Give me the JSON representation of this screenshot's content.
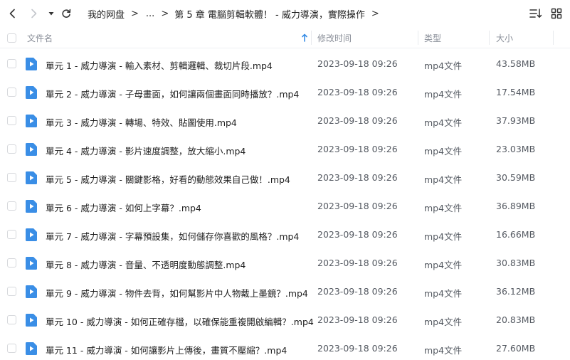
{
  "toolbar": {
    "back_icon": "chevron-left-icon",
    "forward_icon": "chevron-right-icon",
    "history_icon": "caret-down-icon",
    "refresh_icon": "refresh-icon",
    "sort_icon": "sort-list-icon",
    "view_icon": "grid-view-icon"
  },
  "breadcrumb": {
    "root": "我的网盘",
    "ellipsis": "...",
    "current": "第 5 章 電腦剪輯軟體！ - 威力導演，實際操作",
    "separator": ">"
  },
  "header": {
    "name": "文件名",
    "modified": "修改时间",
    "type": "类型",
    "size": "大小"
  },
  "colors": {
    "file_icon": "#3a8ee6",
    "sort_arrow": "#3a8ee6",
    "header_text": "#8a8f99"
  },
  "files": [
    {
      "name": "單元 1 - 威力導演 - 輸入素材、剪輯邏輯、裁切片段.mp4",
      "modified": "2023-09-18 09:26",
      "type": "mp4文件",
      "size": "43.58MB"
    },
    {
      "name": "單元 2 - 威力導演 - 子母畫面，如何讓兩個畫面同時播放？.mp4",
      "modified": "2023-09-18 09:26",
      "type": "mp4文件",
      "size": "17.54MB"
    },
    {
      "name": "單元 3 - 威力導演 - 轉場、特效、貼圖使用.mp4",
      "modified": "2023-09-18 09:26",
      "type": "mp4文件",
      "size": "37.93MB"
    },
    {
      "name": "單元 4 - 威力導演 - 影片速度調整，放大縮小.mp4",
      "modified": "2023-09-18 09:26",
      "type": "mp4文件",
      "size": "23.03MB"
    },
    {
      "name": "單元 5 - 威力導演 - 關鍵影格，好看的動態效果自己做！.mp4",
      "modified": "2023-09-18 09:26",
      "type": "mp4文件",
      "size": "30.59MB"
    },
    {
      "name": "單元 6 - 威力導演 - 如何上字幕？.mp4",
      "modified": "2023-09-18 09:26",
      "type": "mp4文件",
      "size": "36.89MB"
    },
    {
      "name": "單元 7 - 威力導演 - 字幕預設集，如何儲存你喜歡的風格？.mp4",
      "modified": "2023-09-18 09:26",
      "type": "mp4文件",
      "size": "16.66MB"
    },
    {
      "name": "單元 8 - 威力導演 - 音量、不透明度動態調整.mp4",
      "modified": "2023-09-18 09:26",
      "type": "mp4文件",
      "size": "30.83MB"
    },
    {
      "name": "單元 9 - 威力導演 - 物件去背，如何幫影片中人物戴上墨鏡？.mp4",
      "modified": "2023-09-18 09:26",
      "type": "mp4文件",
      "size": "36.12MB"
    },
    {
      "name": "單元 10 - 威力導演 - 如何正確存檔，以確保能重複開啟編輯？.mp4",
      "modified": "2023-09-18 09:26",
      "type": "mp4文件",
      "size": "20.83MB"
    },
    {
      "name": "單元 11 - 威力導演 - 如何讓影片上傳後，畫質不壓縮？.mp4",
      "modified": "2023-09-18 09:26",
      "type": "mp4文件",
      "size": "27.60MB"
    }
  ]
}
